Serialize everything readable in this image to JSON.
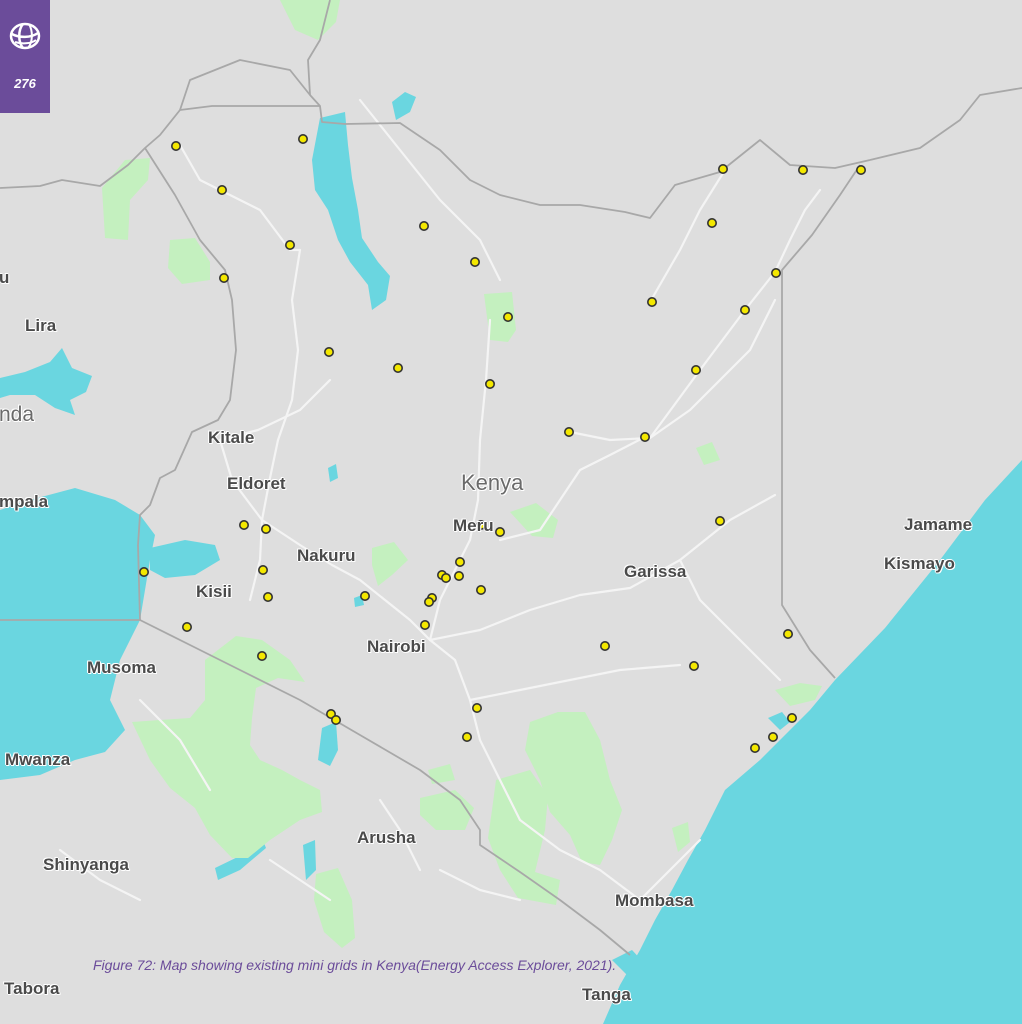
{
  "page_number": "276",
  "caption": "Figure 72: Map showing existing mini grids in Kenya(Energy Access Explorer, 2021).",
  "colors": {
    "land": "#dedede",
    "water": "#6ad6e0",
    "park": "#c4f0bf",
    "road": "#f4f4f4",
    "border": "#a8a8a8",
    "mini_grid_fill": "#f4e800",
    "mini_grid_stroke": "#333333",
    "brand": "#6b4c9a"
  },
  "places": {
    "lira": "Lira",
    "uganda": "nda",
    "u": "u",
    "kitale": "Kitale",
    "eldoret": "Eldoret",
    "kenya": "Kenya",
    "kampala": "mpala",
    "meru": "Meru",
    "nakuru": "Nakuru",
    "kisii": "Kisii",
    "garissa": "Garissa",
    "jamame": "Jamame",
    "kismayo": "Kismayo",
    "nairobi": "Nairobi",
    "musoma": "Musoma",
    "mwanza": "Mwanza",
    "arusha": "Arusha",
    "shinyanga": "Shinyanga",
    "mombasa": "Mombasa",
    "tabora": "Tabora",
    "tanga": "Tanga"
  }
}
